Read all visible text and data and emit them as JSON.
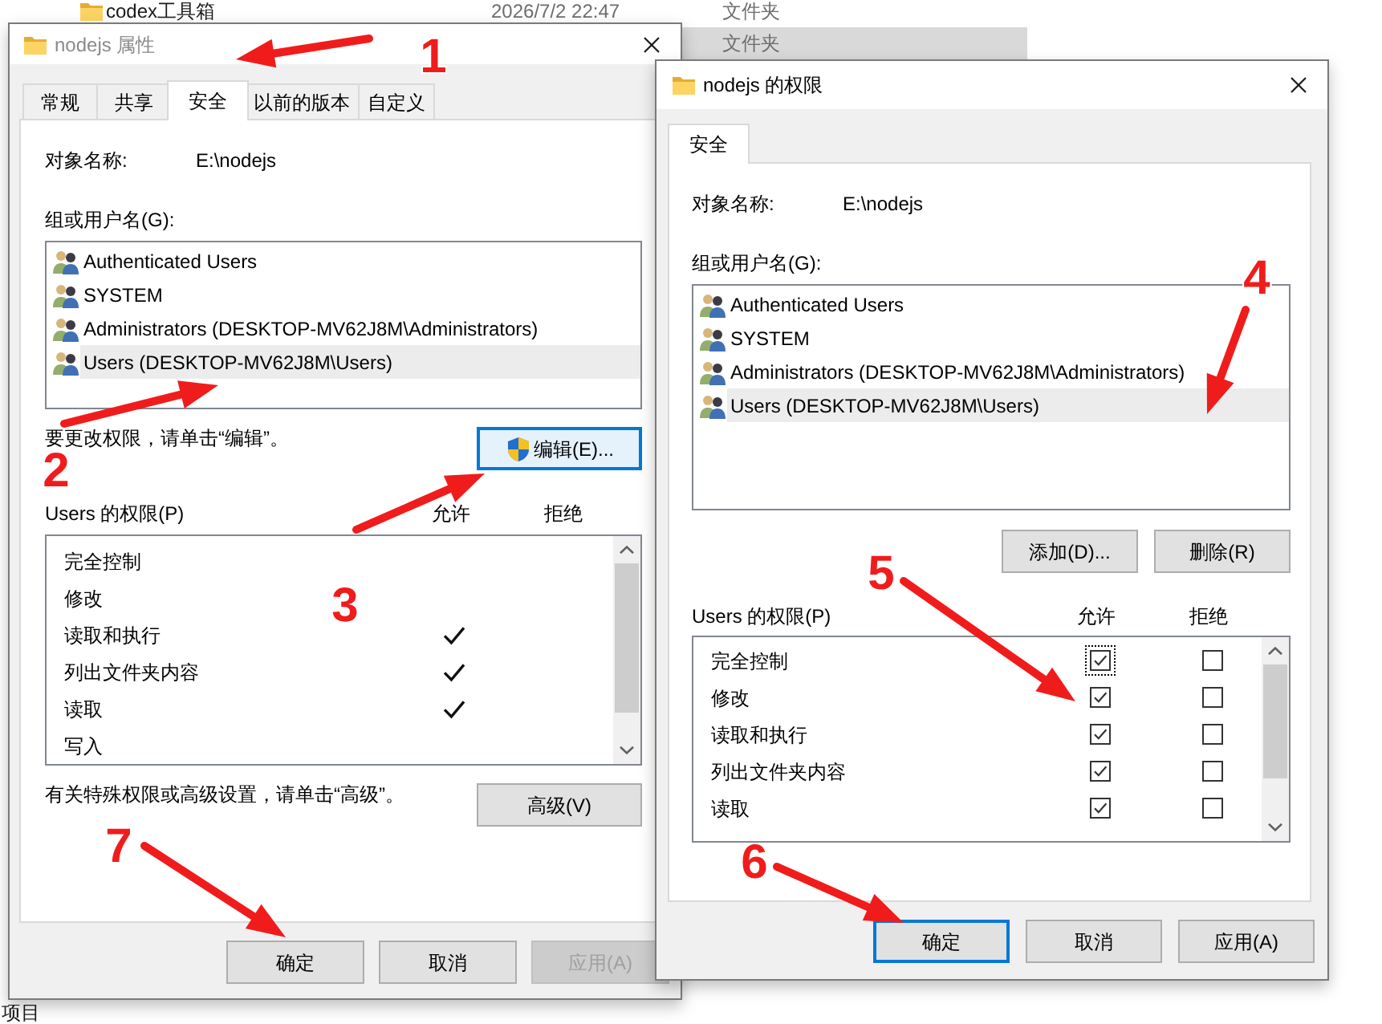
{
  "explorer": {
    "rows": [
      {
        "name": "codex工具箱",
        "modified": "2026/7/2 22:47",
        "type": "文件夹",
        "selected": false
      },
      {
        "type": "文件夹",
        "selected": true
      }
    ],
    "status_bar": "项目"
  },
  "properties_dialog": {
    "title": "nodejs 属性",
    "active": false,
    "tabs": [
      {
        "label": "常规",
        "selected": false
      },
      {
        "label": "共享",
        "selected": false
      },
      {
        "label": "安全",
        "selected": true
      },
      {
        "label": "以前的版本",
        "selected": false
      },
      {
        "label": "自定义",
        "selected": false
      }
    ],
    "object_name_label": "对象名称:",
    "object_name": "E:\\nodejs",
    "groups_label": "组或用户名(G):",
    "groups": [
      {
        "name": "Authenticated Users",
        "selected": false
      },
      {
        "name": "SYSTEM",
        "selected": false
      },
      {
        "name": "Administrators (DESKTOP-MV62J8M\\Administrators)",
        "selected": false
      },
      {
        "name": "Users (DESKTOP-MV62J8M\\Users)",
        "selected": true
      }
    ],
    "edit_hint": "要更改权限，请单击“编辑”。",
    "edit_button": {
      "label": "编辑(E)...",
      "focused": true,
      "hovered": true,
      "disabled": false
    },
    "permissions_label": "Users 的权限(P)",
    "allow_header": "允许",
    "deny_header": "拒绝",
    "permissions": [
      {
        "name": "完全控制",
        "allow": false,
        "deny": false
      },
      {
        "name": "修改",
        "allow": false,
        "deny": false
      },
      {
        "name": "读取和执行",
        "allow": true,
        "deny": false
      },
      {
        "name": "列出文件夹内容",
        "allow": true,
        "deny": false
      },
      {
        "name": "读取",
        "allow": true,
        "deny": false
      },
      {
        "name": "写入",
        "allow": false,
        "deny": false
      }
    ],
    "advanced_hint": "有关特殊权限或高级设置，请单击“高级”。",
    "advanced_button": {
      "label": "高级(V)",
      "focused": false,
      "hovered": false,
      "disabled": false
    },
    "buttons": [
      {
        "label": "确定",
        "focused": false,
        "hovered": false,
        "disabled": false
      },
      {
        "label": "取消",
        "focused": false,
        "hovered": false,
        "disabled": false
      },
      {
        "label": "应用(A)",
        "focused": false,
        "hovered": false,
        "disabled": true
      }
    ]
  },
  "permissions_dialog": {
    "title": "nodejs 的权限",
    "active": true,
    "tabs": [
      {
        "label": "安全",
        "selected": true
      }
    ],
    "object_name_label": "对象名称:",
    "object_name": "E:\\nodejs",
    "groups_label": "组或用户名(G):",
    "groups": [
      {
        "name": "Authenticated Users",
        "selected": false
      },
      {
        "name": "SYSTEM",
        "selected": false
      },
      {
        "name": "Administrators (DESKTOP-MV62J8M\\Administrators)",
        "selected": false
      },
      {
        "name": "Users (DESKTOP-MV62J8M\\Users)",
        "selected": true
      }
    ],
    "add_button": {
      "label": "添加(D)...",
      "focused": false,
      "hovered": false,
      "disabled": false
    },
    "remove_button": {
      "label": "删除(R)",
      "focused": false,
      "hovered": false,
      "disabled": false
    },
    "permissions_label": "Users 的权限(P)",
    "allow_header": "允许",
    "deny_header": "拒绝",
    "permissions": [
      {
        "name": "完全控制",
        "allow": true,
        "deny": false,
        "focused": true
      },
      {
        "name": "修改",
        "allow": true,
        "deny": false,
        "focused": false
      },
      {
        "name": "读取和执行",
        "allow": true,
        "deny": false,
        "focused": false
      },
      {
        "name": "列出文件夹内容",
        "allow": true,
        "deny": false,
        "focused": false
      },
      {
        "name": "读取",
        "allow": true,
        "deny": false,
        "focused": false
      }
    ],
    "buttons": [
      {
        "label": "确定",
        "focused": true,
        "hovered": false,
        "disabled": false
      },
      {
        "label": "取消",
        "focused": false,
        "hovered": false,
        "disabled": false
      },
      {
        "label": "应用(A)",
        "focused": false,
        "hovered": false,
        "disabled": false
      }
    ]
  },
  "annotations": [
    {
      "number": "1"
    },
    {
      "number": "2"
    },
    {
      "number": "3"
    },
    {
      "number": "4"
    },
    {
      "number": "5"
    },
    {
      "number": "6"
    },
    {
      "number": "7"
    }
  ]
}
